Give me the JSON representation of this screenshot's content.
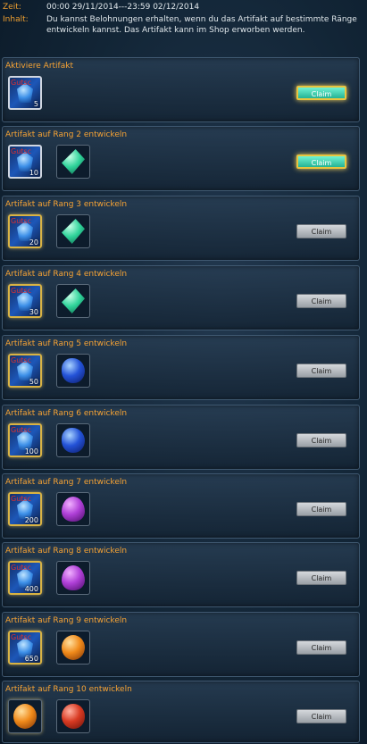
{
  "header": {
    "time_label": "Zeit:",
    "time_value": "00:00 29/11/2014---23:59 02/12/2014",
    "content_label": "Inhalt:",
    "content_value": "Du kannst Belohnungen erhalten, wenn du das Artifakt auf bestimmte Ränge entwickeln kannst. Das Artifakt kann im Shop erworben werden."
  },
  "rows": [
    {
      "title": "Aktiviere Artifakt",
      "slot_tag": "Gutsc",
      "count": "5",
      "reward": "",
      "claim": "Claim",
      "claim_state": "active"
    },
    {
      "title": "Artifakt auf Rang 2 entwickeln",
      "slot_tag": "Gutsc",
      "count": "10",
      "reward": "green",
      "claim": "Claim",
      "claim_state": "active"
    },
    {
      "title": "Artifakt auf Rang 3 entwickeln",
      "slot_tag": "Gutsc",
      "count": "20",
      "reward": "green",
      "claim": "Claim",
      "claim_state": "inactive"
    },
    {
      "title": "Artifakt auf Rang 4 entwickeln",
      "slot_tag": "Gutsc",
      "count": "30",
      "reward": "green",
      "claim": "Claim",
      "claim_state": "inactive"
    },
    {
      "title": "Artifakt auf Rang 5 entwickeln",
      "slot_tag": "Gutsc",
      "count": "50",
      "reward": "blue",
      "claim": "Claim",
      "claim_state": "inactive"
    },
    {
      "title": "Artifakt auf Rang 6 entwickeln",
      "slot_tag": "Gutsc",
      "count": "100",
      "reward": "blue",
      "claim": "Claim",
      "claim_state": "inactive"
    },
    {
      "title": "Artifakt auf Rang 7 entwickeln",
      "slot_tag": "Gutsc",
      "count": "200",
      "reward": "purple",
      "claim": "Claim",
      "claim_state": "inactive"
    },
    {
      "title": "Artifakt auf Rang 8 entwickeln",
      "slot_tag": "Gutsc",
      "count": "400",
      "reward": "purple",
      "claim": "Claim",
      "claim_state": "inactive"
    },
    {
      "title": "Artifakt auf Rang 9 entwickeln",
      "slot_tag": "Gutsc",
      "count": "650",
      "reward": "orange",
      "claim": "Claim",
      "claim_state": "inactive"
    },
    {
      "title": "Artifakt auf Rang 10 entwickeln",
      "slot_tag": "",
      "count": "",
      "reward": "red",
      "claim": "Claim",
      "claim_state": "inactive",
      "first_slot": "orange"
    }
  ],
  "colors": {
    "title": "#f7a334",
    "claim_active": "#26b394",
    "claim_inactive": "#9aa0a6"
  }
}
